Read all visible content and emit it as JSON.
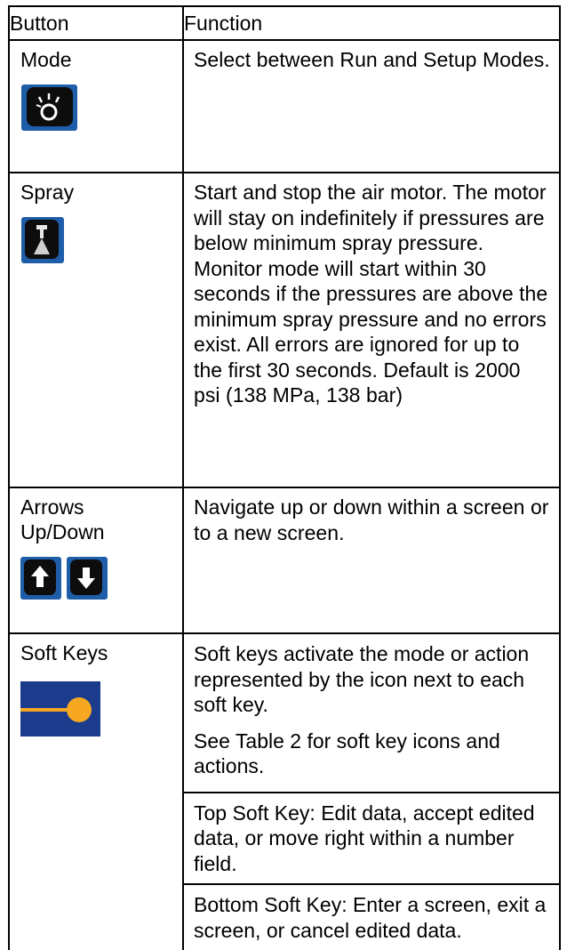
{
  "header": {
    "col1": "Button",
    "col2": "Function"
  },
  "rows": [
    {
      "name": "Mode",
      "desc": "Select between Run and Setup Modes.",
      "icon": "mode-key-icon"
    },
    {
      "name": "Spray",
      "desc": "Start and stop the air motor. The motor will stay on indefinitely if pressures are below minimum spray pressure. Monitor mode will start within 30 seconds if the pressures are above the minimum spray pressure and no errors exist. All errors are ignored for up to the first 30 seconds. Default is 2000 psi (138 MPa, 138 bar)",
      "icon": "spray-gun-key-icon"
    },
    {
      "name": "Arrows Up/Down",
      "desc": "Navigate up or down within a screen or to a new screen.",
      "icons": [
        "arrow-up-key-icon",
        "arrow-down-key-icon"
      ]
    },
    {
      "name": "Soft Keys",
      "icon": "soft-key-icon",
      "desc": [
        "Soft keys activate the mode or action represented by the icon next to each soft key.",
        "See Table 2 for soft key icons and actions.",
        "Top Soft Key: Edit data, accept edited data, or move right within a number field.",
        "Bottom Soft Key: Enter a screen, exit a screen, or cancel edited data."
      ]
    }
  ],
  "colors": {
    "key_blue": "#1e5da8",
    "key_black": "#0d0d0d",
    "soft_key_bg": "#1b3c8c",
    "soft_key_dot": "#f7a823"
  }
}
